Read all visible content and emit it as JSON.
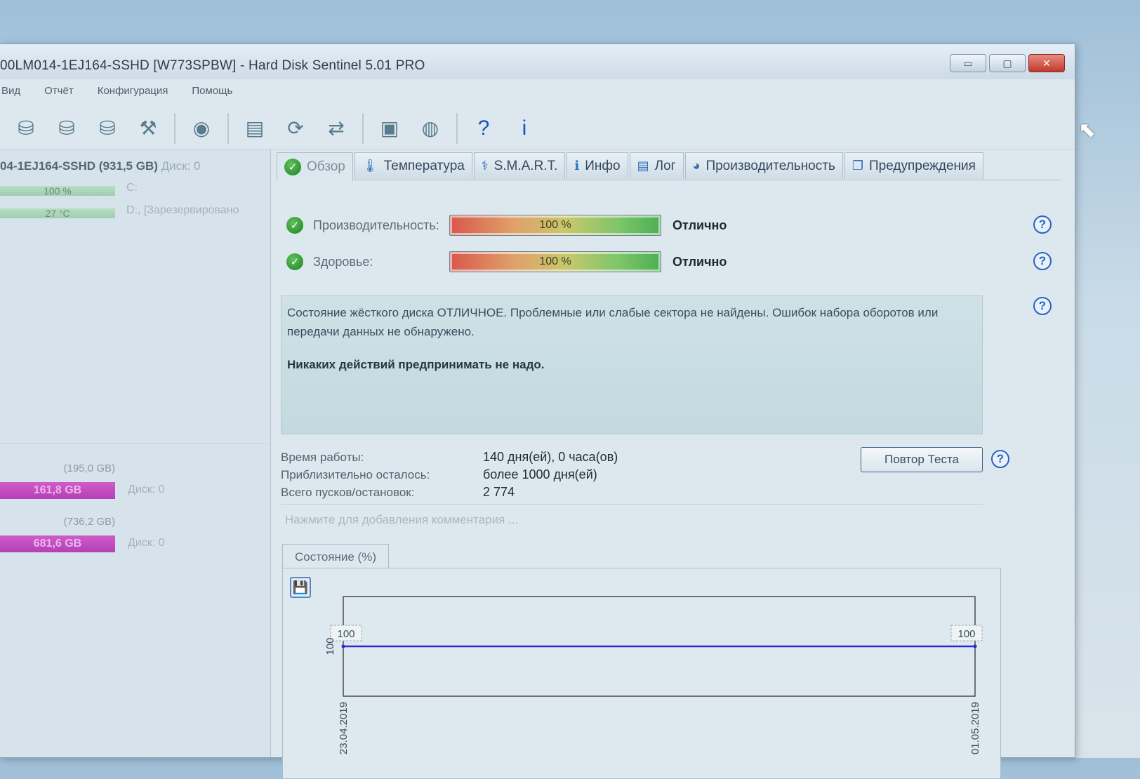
{
  "window": {
    "title": "00LM014-1EJ164-SSHD [W773SPBW] - Hard Disk Sentinel 5.01 PRO",
    "controls": {
      "minimize": "▭",
      "maximize": "▢",
      "close": "✕"
    }
  },
  "menu": [
    "Вид",
    "Отчёт",
    "Конфигурация",
    "Помощь"
  ],
  "toolbar": {
    "icons": [
      "disk-refresh-icon",
      "disk-test-icon",
      "disk-add-icon",
      "disk-tools-icon",
      "globe-icon",
      "report-icon",
      "sync-icon",
      "network-icon",
      "monitor-icon",
      "backup-icon",
      "help-icon",
      "info-icon"
    ],
    "help_glyph": "?",
    "info_glyph": "i"
  },
  "sidebar": {
    "drive_name": "04-1EJ164-SSHD (931,5 GB)",
    "drive_disk": "Диск: 0",
    "health": "100 %",
    "temperature": "27 °C",
    "volumes_label_c": "C:",
    "volumes_label_d": "D:, [Зарезервировано",
    "partitions": [
      {
        "size": "(195,0 GB)",
        "free": "161,8 GB",
        "disk": "Диск: 0"
      },
      {
        "size": "(736,2 GB)",
        "free": "681,6 GB",
        "disk": "Диск: 0"
      }
    ]
  },
  "tabs": [
    {
      "label": "Обзор",
      "icon": "check-icon"
    },
    {
      "label": "Температура",
      "icon": "thermometer-icon"
    },
    {
      "label": "S.M.A.R.T.",
      "icon": "smart-icon"
    },
    {
      "label": "Инфо",
      "icon": "info-icon"
    },
    {
      "label": "Лог",
      "icon": "log-icon"
    },
    {
      "label": "Производительность",
      "icon": "gauge-icon"
    },
    {
      "label": "Предупреждения",
      "icon": "warning-doc-icon"
    }
  ],
  "overview": {
    "performance": {
      "label": "Производительность:",
      "value": "100 %",
      "status": "Отлично",
      "level_percent": 100
    },
    "health": {
      "label": "Здоровье:",
      "value": "100 %",
      "status": "Отлично",
      "level_percent": 100
    },
    "state_text": "Состояние жёсткого диска ОТЛИЧНОЕ. Проблемные или слабые сектора не найдены. Ошибок набора оборотов или передачи данных не обнаружено.",
    "state_action": "Никаких действий предпринимать не надо.",
    "uptime_label": "Время работы:",
    "uptime_value": "140 дня(ей), 0 часа(ов)",
    "remaining_label": "Приблизительно осталось:",
    "remaining_value": "более 1000 дня(ей)",
    "starts_label": "Всего пусков/остановок:",
    "starts_value": "2 774",
    "retest_button": "Повтор Теста",
    "comment_placeholder": "Нажмите для добавления комментария ...",
    "help_glyph": "?"
  },
  "chart_tab": "Состояние (%)",
  "chart_data": {
    "type": "line",
    "x": [
      "23.04.2019",
      "01.05.2019"
    ],
    "series": [
      {
        "values": [
          100,
          100
        ]
      }
    ],
    "ylabel": "100",
    "data_labels": [
      "100",
      "100"
    ],
    "line_color": "#2a2ad6"
  }
}
